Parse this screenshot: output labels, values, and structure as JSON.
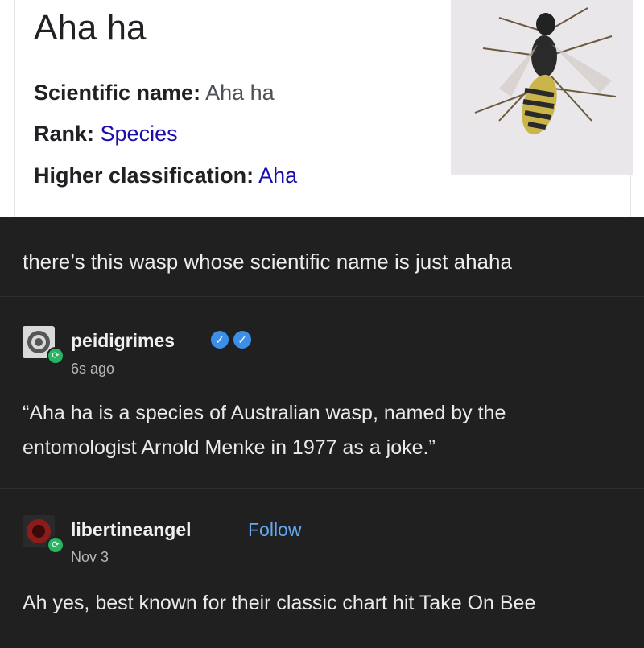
{
  "infobox": {
    "title": "Aha ha",
    "rows": [
      {
        "label": "Scientific name:",
        "value": "Aha ha"
      },
      {
        "label": "Rank:",
        "value": "Species"
      },
      {
        "label": "Higher classification:",
        "value": "Aha"
      }
    ]
  },
  "post": {
    "text": "there’s this wasp whose scientific name is just ahaha"
  },
  "reblogs": [
    {
      "user": "peidigrimes",
      "time": "6s ago",
      "text": "“Aha ha is a species of Australian wasp, named by the entomologist Arnold Menke in 1977 as a joke.”"
    },
    {
      "user": "libertineangel",
      "follow": "Follow",
      "time": "Nov 3",
      "text": "Ah yes, best known for their classic chart hit Take On Bee"
    }
  ]
}
